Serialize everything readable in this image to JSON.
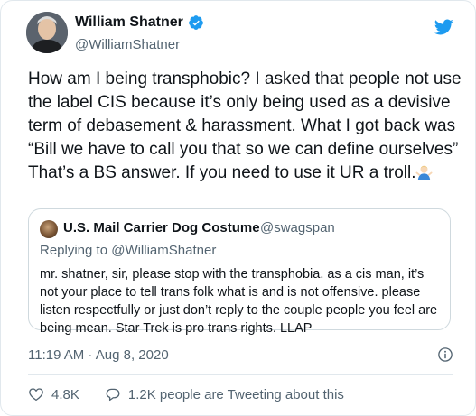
{
  "author": {
    "name": "William Shatner",
    "handle": "@WilliamShatner",
    "verified": true
  },
  "tweet": {
    "text": "How am I being transphobic? I asked that people not use the label CIS because it’s only being used as a devisive term of debasement & harassment. What I got back was “Bill we have to call you that so we can define ourselves” That’s a BS answer. If you need to use it UR a troll.",
    "emoji": "man-shrugging-emoji"
  },
  "quoted_tweet": {
    "author_name": "U.S. Mail Carrier Dog Costume",
    "author_handle": "@swagspan",
    "replying_to_label": "Replying to",
    "replying_to_handle": "@WilliamShatner",
    "text": "mr. shatner, sir, please stop with the transphobia. as a cis man, it’s not your place to tell trans folk what is and is not offensive. please listen respectfully or just don’t reply to the couple people you feel are being mean. Star Trek is pro trans rights. LLAP"
  },
  "meta": {
    "timestamp": "11:19 AM · Aug 8, 2020"
  },
  "actions": {
    "likes": "4.8K",
    "replies_text": "1.2K people are Tweeting about this"
  },
  "colors": {
    "brand_blue": "#1d9bf0",
    "secondary_text": "#536471",
    "border": "#cfd9de"
  },
  "icons": {
    "bird": "twitter-bird-icon",
    "verified": "verified-badge-icon",
    "info": "info-icon",
    "like": "heart-icon",
    "reply": "comment-icon"
  }
}
